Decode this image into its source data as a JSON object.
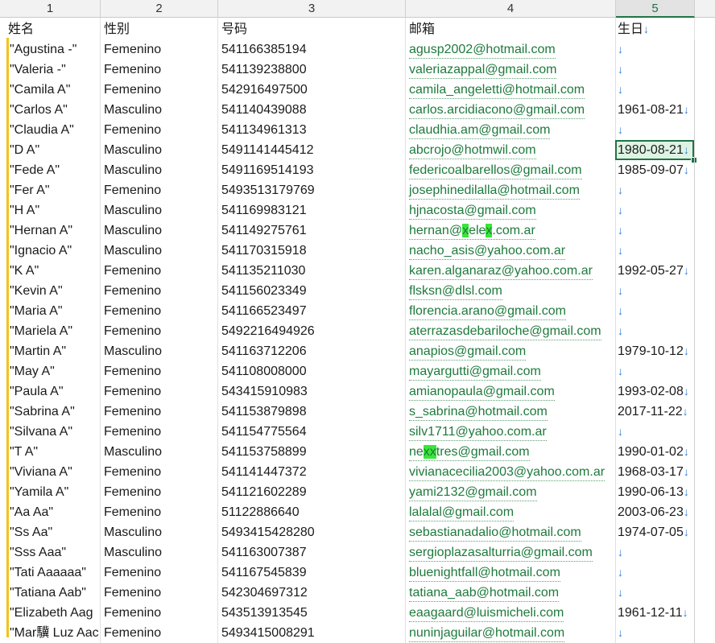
{
  "column_letters": [
    "1",
    "2",
    "3",
    "4",
    "5"
  ],
  "headers": {
    "name": "姓名",
    "gender": "性别",
    "phone": "号码",
    "email": "邮箱",
    "birthday": "生日",
    "birthday_arrow": "↓"
  },
  "arrow_glyph": "↓",
  "rows": [
    {
      "name": "\"Agustina -\"",
      "gender": "Femenino",
      "phone": "541166385194",
      "email_parts": [
        {
          "t": "agusp2002@hotmail.com",
          "h": false
        }
      ],
      "birthday": ""
    },
    {
      "name": "\"Valeria -\"",
      "gender": "Femenino",
      "phone": "541139238800",
      "email_parts": [
        {
          "t": "valeriazappal@gmail.com",
          "h": false
        }
      ],
      "birthday": ""
    },
    {
      "name": "\"Camila A\"",
      "gender": "Femenino",
      "phone": "542916497500",
      "email_parts": [
        {
          "t": "camila_angeletti@hotmail.com",
          "h": false
        }
      ],
      "birthday": ""
    },
    {
      "name": "\"Carlos A\"",
      "gender": "Masculino",
      "phone": "541140439088",
      "email_parts": [
        {
          "t": "carlos.arcidiacono@gmail.com",
          "h": false
        }
      ],
      "birthday": "1961-08-21"
    },
    {
      "name": "\"Claudia A\"",
      "gender": "Femenino",
      "phone": "541134961313",
      "email_parts": [
        {
          "t": "claudhia.am@gmail.com",
          "h": false
        }
      ],
      "birthday": ""
    },
    {
      "name": "\"D A\"",
      "gender": "Masculino",
      "phone": "5491141445412",
      "email_parts": [
        {
          "t": "abcrojo@hotmwil.com",
          "h": false
        }
      ],
      "birthday": "1980-08-21",
      "selected": true
    },
    {
      "name": "\"Fede A\"",
      "gender": "Masculino",
      "phone": "5491169514193",
      "email_parts": [
        {
          "t": "federicoalbarellos@gmail.com",
          "h": false
        }
      ],
      "birthday": "1985-09-07"
    },
    {
      "name": "\"Fer A\"",
      "gender": "Femenino",
      "phone": "5493513179769",
      "email_parts": [
        {
          "t": "josephinedilalla@hotmail.com",
          "h": false
        }
      ],
      "birthday": ""
    },
    {
      "name": "\"H A\"",
      "gender": "Masculino",
      "phone": "541169983121",
      "email_parts": [
        {
          "t": "hjnacosta@gmail.com",
          "h": false
        }
      ],
      "birthday": ""
    },
    {
      "name": "\"Hernan A\"",
      "gender": "Masculino",
      "phone": "541149275761",
      "email_parts": [
        {
          "t": "hernan@",
          "h": false
        },
        {
          "t": "x",
          "h": true
        },
        {
          "t": "ele",
          "h": false
        },
        {
          "t": "x",
          "h": true
        },
        {
          "t": ".com.ar",
          "h": false
        }
      ],
      "birthday": ""
    },
    {
      "name": "\"Ignacio A\"",
      "gender": "Masculino",
      "phone": "541170315918",
      "email_parts": [
        {
          "t": "nacho_asis@yahoo.com.ar",
          "h": false
        }
      ],
      "birthday": ""
    },
    {
      "name": "\"K A\"",
      "gender": "Femenino",
      "phone": "541135211030",
      "email_parts": [
        {
          "t": "karen.alganaraz@yahoo.com.ar",
          "h": false
        }
      ],
      "birthday": "1992-05-27"
    },
    {
      "name": "\"Kevin A\"",
      "gender": "Femenino",
      "phone": "541156023349",
      "email_parts": [
        {
          "t": "flsksn@dlsl.com",
          "h": false
        }
      ],
      "birthday": ""
    },
    {
      "name": "\"Maria A\"",
      "gender": "Femenino",
      "phone": "541166523497",
      "email_parts": [
        {
          "t": "florencia.arano@gmail.com",
          "h": false
        }
      ],
      "birthday": ""
    },
    {
      "name": "\"Mariela A\"",
      "gender": "Femenino",
      "phone": "5492216494926",
      "email_parts": [
        {
          "t": "aterrazasdebariloche@gmail.com",
          "h": false
        }
      ],
      "birthday": ""
    },
    {
      "name": "\"Martin A\"",
      "gender": "Masculino",
      "phone": "541163712206",
      "email_parts": [
        {
          "t": "anapios@gmail.com",
          "h": false
        }
      ],
      "birthday": "1979-10-12"
    },
    {
      "name": "\"May A\"",
      "gender": "Femenino",
      "phone": "541108008000",
      "email_parts": [
        {
          "t": "mayargutti@gmail.com",
          "h": false
        }
      ],
      "birthday": ""
    },
    {
      "name": "\"Paula A\"",
      "gender": "Femenino",
      "phone": "543415910983",
      "email_parts": [
        {
          "t": "amianopaula@gmail.com",
          "h": false
        }
      ],
      "birthday": "1993-02-08"
    },
    {
      "name": "\"Sabrina A\"",
      "gender": "Femenino",
      "phone": "541153879898",
      "email_parts": [
        {
          "t": "s_sabrina@hotmail.com",
          "h": false
        }
      ],
      "birthday": "2017-11-22"
    },
    {
      "name": "\"Silvana A\"",
      "gender": "Femenino",
      "phone": "541154775564",
      "email_parts": [
        {
          "t": "silv1711@yahoo.com.ar",
          "h": false
        }
      ],
      "birthday": ""
    },
    {
      "name": "\"T A\"",
      "gender": "Masculino",
      "phone": "541153758899",
      "email_parts": [
        {
          "t": "ne",
          "h": false
        },
        {
          "t": "xx",
          "h": true
        },
        {
          "t": "tres@gmail.com",
          "h": false
        }
      ],
      "birthday": "1990-01-02"
    },
    {
      "name": "\"Viviana A\"",
      "gender": "Femenino",
      "phone": "541141447372",
      "email_parts": [
        {
          "t": "vivianacecilia2003@yahoo.com.ar",
          "h": false
        }
      ],
      "birthday": "1968-03-17"
    },
    {
      "name": "\"Yamila A\"",
      "gender": "Femenino",
      "phone": "541121602289",
      "email_parts": [
        {
          "t": "yami2132@gmail.com",
          "h": false
        }
      ],
      "birthday": "1990-06-13"
    },
    {
      "name": "\"Aa Aa\"",
      "gender": "Femenino",
      "phone": "51122886640",
      "email_parts": [
        {
          "t": "lalalal@gmail.com",
          "h": false
        }
      ],
      "birthday": "2003-06-23"
    },
    {
      "name": "\"Ss Aa\"",
      "gender": "Masculino",
      "phone": "5493415428280",
      "email_parts": [
        {
          "t": "sebastianadalio@hotmail.com",
          "h": false
        }
      ],
      "birthday": "1974-07-05"
    },
    {
      "name": "\"Sss Aaa\"",
      "gender": "Masculino",
      "phone": "541163007387",
      "email_parts": [
        {
          "t": "sergioplazasalturria@gmail.com",
          "h": false
        }
      ],
      "birthday": ""
    },
    {
      "name": "\"Tati Aaaaaa\"",
      "gender": "Femenino",
      "phone": "541167545839",
      "email_parts": [
        {
          "t": "bluenightfall@hotmail.com",
          "h": false
        }
      ],
      "birthday": ""
    },
    {
      "name": "\"Tatiana Aab\"",
      "gender": "Femenino",
      "phone": "542304697312",
      "email_parts": [
        {
          "t": "tatiana_aab@hotmail.com",
          "h": false
        }
      ],
      "birthday": ""
    },
    {
      "name": "\"Elizabeth Aag",
      "gender": "Femenino",
      "phone": "543513913545",
      "email_parts": [
        {
          "t": "eaagaard@luismicheli.com",
          "h": false
        }
      ],
      "birthday": "1961-12-11"
    },
    {
      "name": "\"Mar驥 Luz Aac",
      "gender": "Femenino",
      "phone": "5493415008291",
      "email_parts": [
        {
          "t": "nuninjaguilar@hotmail.com",
          "h": false
        }
      ],
      "birthday": ""
    }
  ],
  "colors": {
    "link_green": "#1e7a3c",
    "highlight_green": "#39e639",
    "arrow_blue": "#2f7fd8",
    "selection_green": "#217346",
    "left_bar_yellow": "#f2c318"
  }
}
